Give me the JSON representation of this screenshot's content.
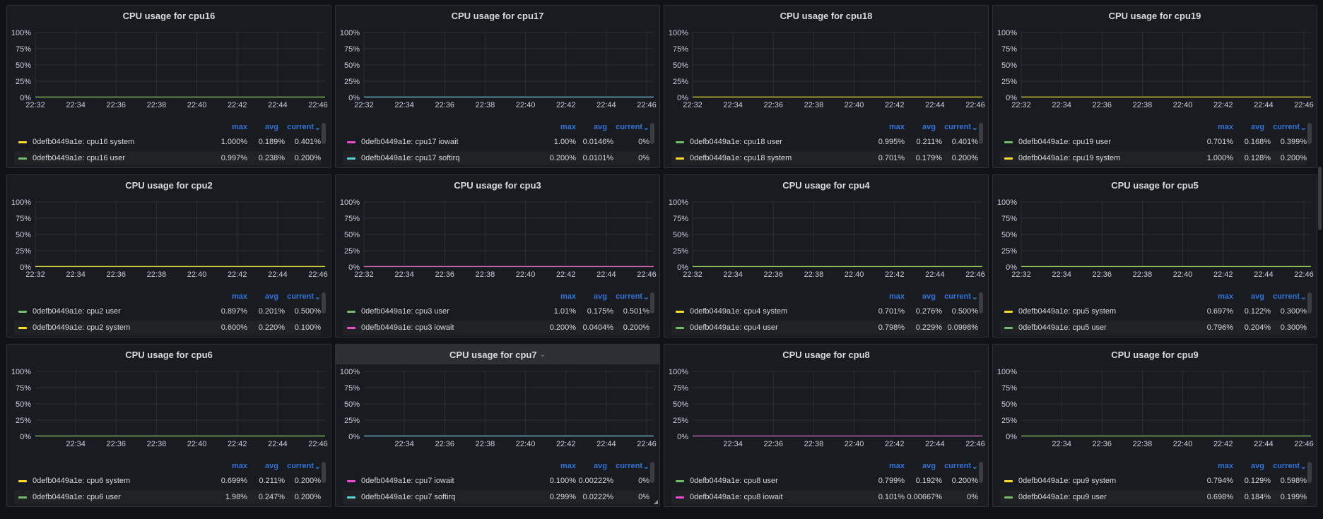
{
  "colors": {
    "green": "#73bf69",
    "yellow": "#fade2a",
    "pink": "#e84ecf",
    "cyan": "#5dd6d6",
    "header": "#3274d9"
  },
  "legend_headers": {
    "max": "max",
    "avg": "avg",
    "current": "current"
  },
  "y_ticks": [
    "100%",
    "75%",
    "50%",
    "25%",
    "0%"
  ],
  "panels": [
    {
      "title": "CPU usage for cpu16",
      "x_ticks": [
        "22:32",
        "22:34",
        "22:36",
        "22:38",
        "22:40",
        "22:42",
        "22:44",
        "22:46"
      ],
      "series": [
        {
          "name": "0defb0449a1e: cpu16 system",
          "color": "yellow",
          "max": "1.000%",
          "avg": "0.189%",
          "current": "0.401%"
        },
        {
          "name": "0defb0449a1e: cpu16 user",
          "color": "green",
          "max": "0.997%",
          "avg": "0.238%",
          "current": "0.200%"
        }
      ]
    },
    {
      "title": "CPU usage for cpu17",
      "x_ticks": [
        "22:32",
        "22:34",
        "22:36",
        "22:38",
        "22:40",
        "22:42",
        "22:44",
        "22:46"
      ],
      "series": [
        {
          "name": "0defb0449a1e: cpu17 iowait",
          "color": "pink",
          "max": "1.00%",
          "avg": "0.0146%",
          "current": "0%"
        },
        {
          "name": "0defb0449a1e: cpu17 softirq",
          "color": "cyan",
          "max": "0.200%",
          "avg": "0.0101%",
          "current": "0%"
        }
      ]
    },
    {
      "title": "CPU usage for cpu18",
      "x_ticks": [
        "22:32",
        "22:34",
        "22:36",
        "22:38",
        "22:40",
        "22:42",
        "22:44",
        "22:46"
      ],
      "series": [
        {
          "name": "0defb0449a1e: cpu18 user",
          "color": "green",
          "max": "0.995%",
          "avg": "0.211%",
          "current": "0.401%"
        },
        {
          "name": "0defb0449a1e: cpu18 system",
          "color": "yellow",
          "max": "0.701%",
          "avg": "0.179%",
          "current": "0.200%"
        }
      ]
    },
    {
      "title": "CPU usage for cpu19",
      "x_ticks": [
        "22:32",
        "22:34",
        "22:36",
        "22:38",
        "22:40",
        "22:42",
        "22:44",
        "22:46"
      ],
      "series": [
        {
          "name": "0defb0449a1e: cpu19 user",
          "color": "green",
          "max": "0.701%",
          "avg": "0.168%",
          "current": "0.399%"
        },
        {
          "name": "0defb0449a1e: cpu19 system",
          "color": "yellow",
          "max": "1.000%",
          "avg": "0.128%",
          "current": "0.200%"
        }
      ]
    },
    {
      "title": "CPU usage for cpu2",
      "x_ticks": [
        "22:32",
        "22:34",
        "22:36",
        "22:38",
        "22:40",
        "22:42",
        "22:44",
        "22:46"
      ],
      "series": [
        {
          "name": "0defb0449a1e: cpu2 user",
          "color": "green",
          "max": "0.897%",
          "avg": "0.201%",
          "current": "0.500%"
        },
        {
          "name": "0defb0449a1e: cpu2 system",
          "color": "yellow",
          "max": "0.600%",
          "avg": "0.220%",
          "current": "0.100%"
        }
      ]
    },
    {
      "title": "CPU usage for cpu3",
      "x_ticks": [
        "22:32",
        "22:34",
        "22:36",
        "22:38",
        "22:40",
        "22:42",
        "22:44",
        "22:46"
      ],
      "series": [
        {
          "name": "0defb0449a1e: cpu3 user",
          "color": "green",
          "max": "1.01%",
          "avg": "0.175%",
          "current": "0.501%"
        },
        {
          "name": "0defb0449a1e: cpu3 iowait",
          "color": "pink",
          "max": "0.200%",
          "avg": "0.0404%",
          "current": "0.200%"
        }
      ]
    },
    {
      "title": "CPU usage for cpu4",
      "x_ticks": [
        "22:32",
        "22:34",
        "22:36",
        "22:38",
        "22:40",
        "22:42",
        "22:44",
        "22:46"
      ],
      "series": [
        {
          "name": "0defb0449a1e: cpu4 system",
          "color": "yellow",
          "max": "0.701%",
          "avg": "0.276%",
          "current": "0.500%"
        },
        {
          "name": "0defb0449a1e: cpu4 user",
          "color": "green",
          "max": "0.798%",
          "avg": "0.229%",
          "current": "0.0998%"
        }
      ]
    },
    {
      "title": "CPU usage for cpu5",
      "x_ticks": [
        "22:32",
        "22:34",
        "22:36",
        "22:38",
        "22:40",
        "22:42",
        "22:44",
        "22:46"
      ],
      "series": [
        {
          "name": "0defb0449a1e: cpu5 system",
          "color": "yellow",
          "max": "0.697%",
          "avg": "0.122%",
          "current": "0.300%"
        },
        {
          "name": "0defb0449a1e: cpu5 user",
          "color": "green",
          "max": "0.796%",
          "avg": "0.204%",
          "current": "0.300%"
        }
      ]
    },
    {
      "title": "CPU usage for cpu6",
      "x_ticks": [
        "22:34",
        "22:36",
        "22:38",
        "22:40",
        "22:42",
        "22:44",
        "22:46"
      ],
      "series": [
        {
          "name": "0defb0449a1e: cpu6 system",
          "color": "yellow",
          "max": "0.699%",
          "avg": "0.211%",
          "current": "0.200%"
        },
        {
          "name": "0defb0449a1e: cpu6 user",
          "color": "green",
          "max": "1.98%",
          "avg": "0.247%",
          "current": "0.200%"
        }
      ]
    },
    {
      "title": "CPU usage for cpu7",
      "selected": true,
      "x_ticks": [
        "22:34",
        "22:36",
        "22:38",
        "22:40",
        "22:42",
        "22:44",
        "22:46"
      ],
      "series": [
        {
          "name": "0defb0449a1e: cpu7 iowait",
          "color": "pink",
          "max": "0.100%",
          "avg": "0.00222%",
          "current": "0%"
        },
        {
          "name": "0defb0449a1e: cpu7 softirq",
          "color": "cyan",
          "max": "0.299%",
          "avg": "0.0222%",
          "current": "0%"
        }
      ]
    },
    {
      "title": "CPU usage for cpu8",
      "x_ticks": [
        "22:34",
        "22:36",
        "22:38",
        "22:40",
        "22:42",
        "22:44",
        "22:46"
      ],
      "series": [
        {
          "name": "0defb0449a1e: cpu8 user",
          "color": "green",
          "max": "0.799%",
          "avg": "0.192%",
          "current": "0.200%"
        },
        {
          "name": "0defb0449a1e: cpu8 iowait",
          "color": "pink",
          "max": "0.101%",
          "avg": "0.00667%",
          "current": "0%"
        }
      ]
    },
    {
      "title": "CPU usage for cpu9",
      "x_ticks": [
        "22:34",
        "22:36",
        "22:38",
        "22:40",
        "22:42",
        "22:44",
        "22:46"
      ],
      "series": [
        {
          "name": "0defb0449a1e: cpu9 system",
          "color": "yellow",
          "max": "0.794%",
          "avg": "0.129%",
          "current": "0.598%"
        },
        {
          "name": "0defb0449a1e: cpu9 user",
          "color": "green",
          "max": "0.698%",
          "avg": "0.184%",
          "current": "0.199%"
        }
      ]
    }
  ]
}
